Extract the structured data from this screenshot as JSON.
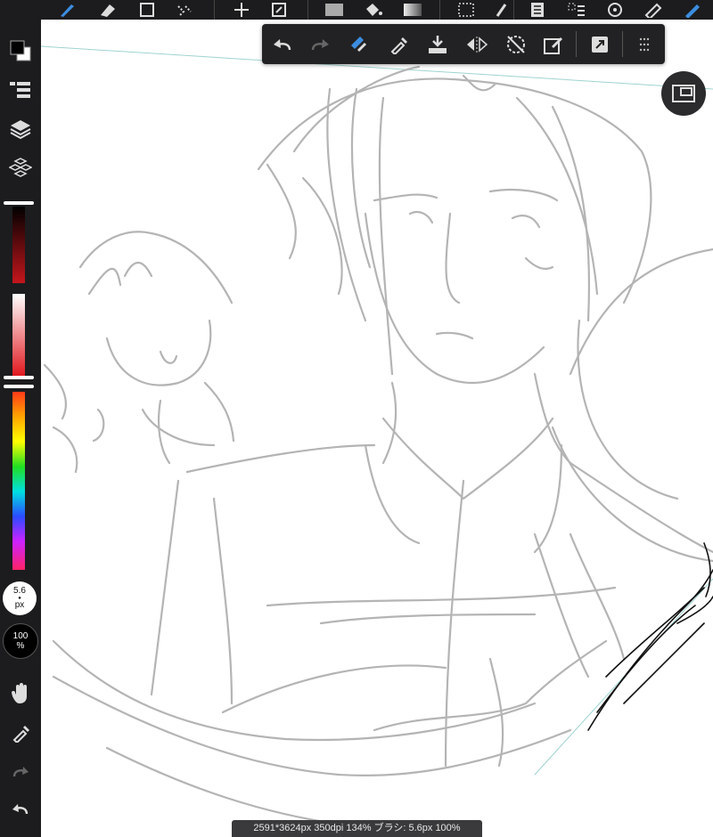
{
  "status_bar": {
    "text": "2591*3624px 350dpi 134% ブラシ: 5.6px 100%"
  },
  "brush": {
    "size_value": "5.6",
    "size_unit": "px"
  },
  "opacity": {
    "value": "100",
    "unit": "%"
  },
  "colors": {
    "accent": "#3b8de0",
    "toolbar_bg": "#1c1c1e",
    "sketch_stroke": "#b4b4b4",
    "foreground_color": "#000000",
    "background_color": "#ffffff"
  },
  "toolbar_icons": [
    "menu-icon",
    "brush-icon",
    "eraser-icon",
    "fill-rect-icon",
    "magic-wand-icon",
    "move-icon",
    "transform-icon",
    "color-swatch-icon",
    "bucket-icon",
    "gradient-icon",
    "selection-icon",
    "pen-icon",
    "layer-menu-icon",
    "selection-list-icon",
    "rotate-icon",
    "ruler-icon",
    "pen-tool-icon"
  ],
  "float_toolbar_icons": [
    "undo-icon",
    "redo-icon",
    "clear-icon",
    "eyedropper-icon",
    "import-icon",
    "flip-horizontal-icon",
    "rotate-off-icon",
    "edit-icon",
    "external-icon",
    "grid-icon"
  ],
  "sidebar_icons": [
    "color-icon",
    "layer-list-icon",
    "layers-icon",
    "materials-icon",
    "hand-icon",
    "eyedropper-icon",
    "redo-icon",
    "undo-icon"
  ]
}
